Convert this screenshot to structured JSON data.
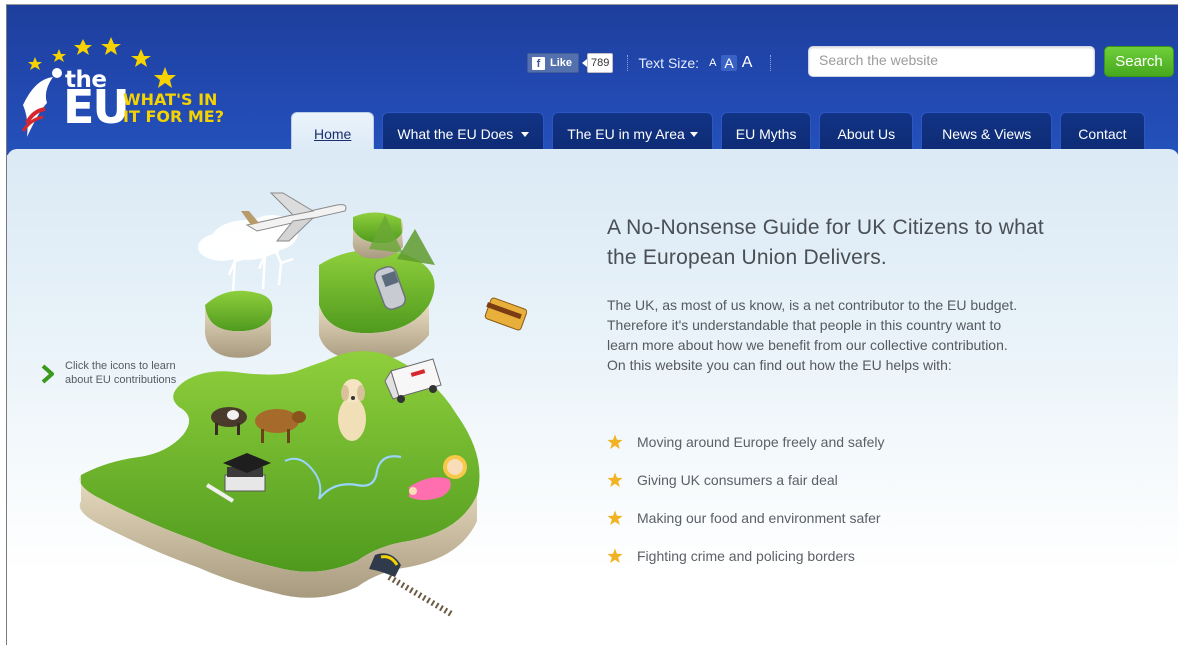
{
  "logo": {
    "the": "the",
    "eu": "EU",
    "tagline_1": "WHAT'S IN",
    "tagline_2": "IT FOR ME?"
  },
  "utility": {
    "like_label": "Like",
    "like_count": "789",
    "text_size_label": "Text Size:",
    "text_size_options": [
      "A",
      "A",
      "A"
    ],
    "selected_text_size": "medium"
  },
  "search": {
    "placeholder": "Search the website",
    "button_label": "Search"
  },
  "nav": {
    "tabs": [
      {
        "label": "Home",
        "active": true,
        "dropdown": false
      },
      {
        "label": "What the EU Does",
        "active": false,
        "dropdown": true
      },
      {
        "label": "The EU in my Area",
        "active": false,
        "dropdown": true
      },
      {
        "label": "EU Myths",
        "active": false,
        "dropdown": false
      },
      {
        "label": "About Us",
        "active": false,
        "dropdown": false
      },
      {
        "label": "News & Views",
        "active": false,
        "dropdown": false
      },
      {
        "label": "Contact",
        "active": false,
        "dropdown": false
      }
    ]
  },
  "hint": {
    "line1": "Click the icons to learn",
    "line2": "about EU contributions"
  },
  "main": {
    "headline_1": "A No-Nonsense Guide for UK Citizens to what",
    "headline_2": "the European Union Delivers.",
    "intro_1": "The UK, as most of us know, is a net contributor to the EU budget.",
    "intro_2": "Therefore it's understandable that people in this country want to",
    "intro_3": "learn more about how we benefit from our collective contribution.",
    "intro_4": "On this website you can find out how the EU helps with:",
    "benefits": [
      "Moving around Europe freely and safely",
      "Giving UK consumers a fair deal",
      "Making our food and environment safer",
      "Fighting crime and policing borders"
    ]
  },
  "colors": {
    "header_blue": "#2147ad",
    "tab_navy": "#0d2a73",
    "search_green": "#46a81e",
    "logo_yellow": "#f5d200",
    "star_gold": "#f0b323",
    "hint_green": "#3a9a1c"
  }
}
